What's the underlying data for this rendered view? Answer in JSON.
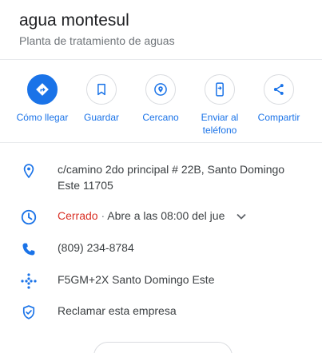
{
  "place": {
    "name": "agua montesul",
    "category": "Planta de tratamiento de aguas"
  },
  "actions": [
    {
      "label": "Cómo llegar",
      "icon": "directions-icon"
    },
    {
      "label": "Guardar",
      "icon": "bookmark-icon"
    },
    {
      "label": "Cercano",
      "icon": "nearby-icon"
    },
    {
      "label": "Enviar al teléfono",
      "label_line1": "Enviar al",
      "label_line2": "teléfono",
      "icon": "phone-send-icon"
    },
    {
      "label": "Compartir",
      "icon": "share-icon"
    }
  ],
  "info": {
    "address_line1": "c/camino 2do principal # 22B, Santo Domingo",
    "address_line2": "Este 11705",
    "hours_status": "Cerrado",
    "hours_separator": " · ",
    "hours_detail": "Abre a las 08:00 del jue",
    "phone": "(809) 234-8784",
    "plus_code": "F5GM+2X Santo Domingo Este",
    "claim": "Reclamar esta empresa"
  },
  "colors": {
    "accent": "#1a73e8",
    "closed": "#d93025",
    "text": "#3c4043",
    "muted": "#70757a"
  }
}
